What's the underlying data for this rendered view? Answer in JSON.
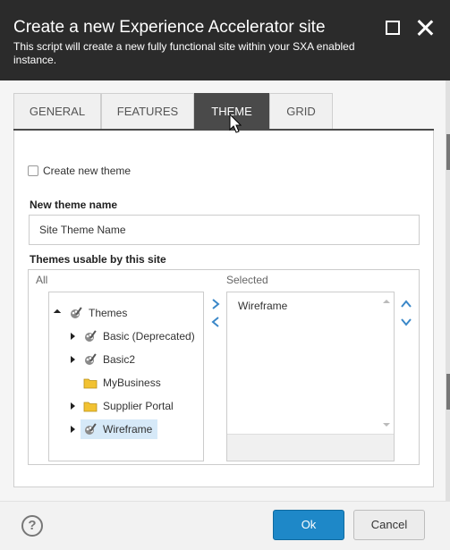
{
  "dialog": {
    "title": "Create a new Experience Accelerator site",
    "subtitle": "This script will create a new fully functional site within your SXA enabled instance."
  },
  "tabs": [
    {
      "label": "GENERAL"
    },
    {
      "label": "FEATURES"
    },
    {
      "label": "THEME",
      "active": true
    },
    {
      "label": "GRID"
    }
  ],
  "theme": {
    "create_new_theme_label": "Create new theme",
    "create_new_theme_checked": false,
    "new_theme_name_label": "New theme name",
    "new_theme_name_value": "Site Theme Name",
    "themes_usable_label": "Themes usable by this site",
    "all_label": "All",
    "selected_label": "Selected",
    "tree": {
      "root": "Themes",
      "children": [
        {
          "label": "Basic (Deprecated)",
          "icon": "theme-icon",
          "expandable": true
        },
        {
          "label": "Basic2",
          "icon": "theme-icon",
          "expandable": true
        },
        {
          "label": "MyBusiness",
          "icon": "folder-icon",
          "expandable": false
        },
        {
          "label": "Supplier Portal",
          "icon": "folder-icon",
          "expandable": true
        },
        {
          "label": "Wireframe",
          "icon": "theme-icon",
          "expandable": true,
          "selected": true
        }
      ]
    },
    "selected_items": [
      "Wireframe"
    ]
  },
  "footer": {
    "help_label": "?",
    "ok_label": "Ok",
    "cancel_label": "Cancel"
  },
  "colors": {
    "titlebar": "#2b2b2b",
    "active_tab": "#4a4a4a",
    "primary_button": "#1e88c8",
    "selection": "#d6e9f8",
    "arrow_accent": "#3a87c8"
  }
}
